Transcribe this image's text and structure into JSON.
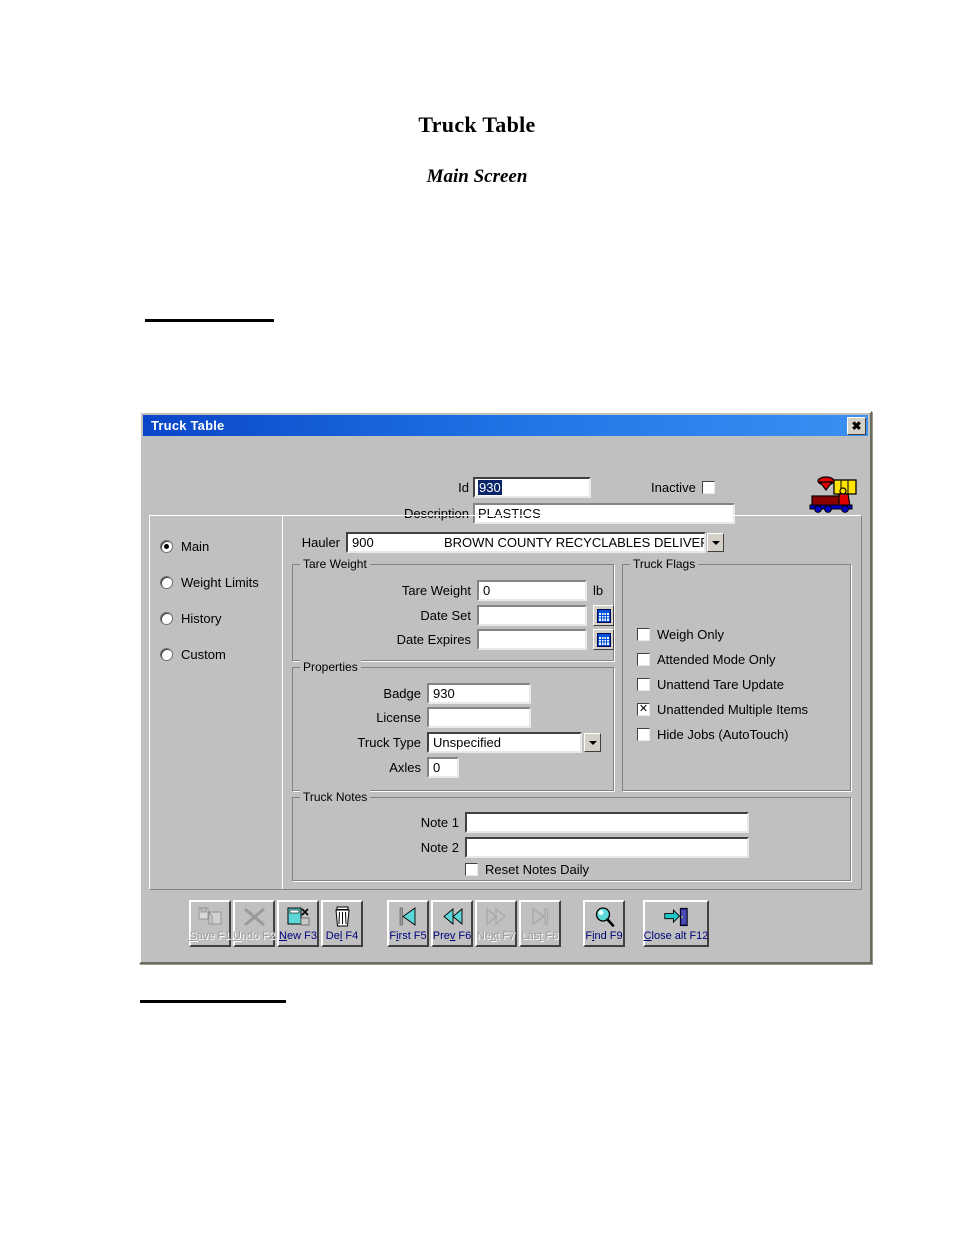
{
  "document": {
    "title": "Truck Table",
    "subtitle": "Main Screen"
  },
  "window": {
    "title": "Truck Table",
    "close_label": "✖",
    "close_icon": "close-icon",
    "app_icon": "dump-truck-icon",
    "accent_title_color": "#0a46c8",
    "face_color": "#c0c0c0"
  },
  "header": {
    "id_label": "Id",
    "id_value": "930",
    "id_selected": true,
    "description_label": "Description",
    "description_value": "PLASTICS",
    "inactive_label": "Inactive",
    "inactive_checked": false,
    "inactive_mark": ""
  },
  "sidebar": {
    "items": [
      {
        "label": "Main",
        "selected": true
      },
      {
        "label": "Weight Limits",
        "selected": false
      },
      {
        "label": "History",
        "selected": false
      },
      {
        "label": "Custom",
        "selected": false
      }
    ]
  },
  "hauler": {
    "label": "Hauler",
    "code": "900",
    "name": "BROWN COUNTY RECYCLABLES DELIVERED",
    "dropdown_icon": "chevron-down-icon"
  },
  "tare_weight": {
    "group_title": "Tare Weight",
    "tare_weight_label": "Tare Weight",
    "tare_weight_value": "0",
    "tare_weight_unit": "lb",
    "date_set_label": "Date Set",
    "date_set_value": "",
    "date_expires_label": "Date Expires",
    "date_expires_value": "",
    "calendar_icon": "calendar-icon"
  },
  "properties": {
    "group_title": "Properties",
    "badge_label": "Badge",
    "badge_value": "930",
    "license_label": "License",
    "license_value": "",
    "truck_type_label": "Truck Type",
    "truck_type_value": "Unspecified",
    "axles_label": "Axles",
    "axles_value": "0",
    "dropdown_icon": "chevron-down-icon"
  },
  "truck_flags": {
    "group_title": "Truck Flags",
    "items": [
      {
        "label": "Weigh Only",
        "checked": false,
        "mark": ""
      },
      {
        "label": "Attended Mode Only",
        "checked": false,
        "mark": ""
      },
      {
        "label": "Unattend Tare Update",
        "checked": false,
        "mark": ""
      },
      {
        "label": "Unattended Multiple Items",
        "checked": true,
        "mark": "✕"
      },
      {
        "label": "Hide Jobs (AutoTouch)",
        "checked": false,
        "mark": ""
      }
    ]
  },
  "truck_notes": {
    "group_title": "Truck Notes",
    "note1_label": "Note 1",
    "note1_value": "",
    "note2_label": "Note 2",
    "note2_value": "",
    "reset_label": "Reset Notes Daily",
    "reset_checked": false,
    "reset_mark": ""
  },
  "toolbar": {
    "buttons": [
      {
        "name": "save-button",
        "label_pre": "",
        "label_key": "S",
        "label_post": "ave F1",
        "enabled": false,
        "icon": "save-icon"
      },
      {
        "name": "undo-button",
        "label_pre": "",
        "label_key": "U",
        "label_post": "ndo F2",
        "enabled": false,
        "icon": "undo-x-icon"
      },
      {
        "name": "new-button",
        "label_pre": "",
        "label_key": "N",
        "label_post": "ew F3",
        "enabled": true,
        "icon": "new-page-icon"
      },
      {
        "name": "delete-button",
        "label_pre": "De",
        "label_key": "l",
        "label_post": " F4",
        "enabled": true,
        "icon": "trash-icon"
      },
      {
        "name": "first-button",
        "label_pre": "F",
        "label_key": "i",
        "label_post": "rst F5",
        "enabled": true,
        "icon": "first-record-icon"
      },
      {
        "name": "prev-button",
        "label_pre": "Pre",
        "label_key": "v",
        "label_post": " F6",
        "enabled": true,
        "icon": "prev-record-icon"
      },
      {
        "name": "next-button",
        "label_pre": "Ne",
        "label_key": "x",
        "label_post": "t F7",
        "enabled": false,
        "icon": "next-record-icon"
      },
      {
        "name": "last-button",
        "label_pre": "Las",
        "label_key": "t",
        "label_post": " F8",
        "enabled": false,
        "icon": "last-record-icon"
      },
      {
        "name": "find-button",
        "label_pre": "F",
        "label_key": "i",
        "label_post": "nd F9",
        "enabled": true,
        "icon": "magnifier-icon"
      },
      {
        "name": "close-button",
        "label_pre": "",
        "label_key": "C",
        "label_post": "lose alt F12",
        "enabled": true,
        "icon": "exit-door-icon"
      }
    ]
  }
}
